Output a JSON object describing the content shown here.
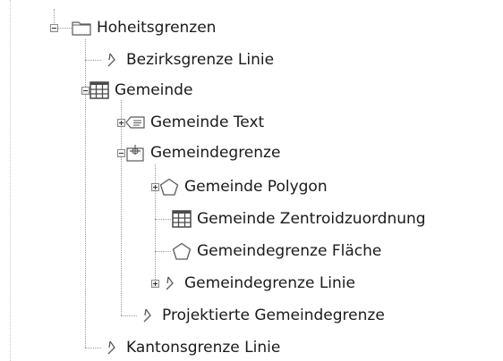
{
  "tree": {
    "root": {
      "label": "Hoheitsgrenzen",
      "icon": "folder-icon",
      "expanded": true,
      "children": [
        {
          "label": "Bezirksgrenze Linie",
          "icon": "line-feature-icon"
        },
        {
          "label": "Gemeinde",
          "icon": "table-icon",
          "expanded": true,
          "children": [
            {
              "label": "Gemeinde Text",
              "icon": "text-feature-icon",
              "expanded": false
            },
            {
              "label": "Gemeindegrenze",
              "icon": "topic-icon",
              "expanded": true,
              "children": [
                {
                  "label": "Gemeinde Polygon",
                  "icon": "polygon-feature-icon",
                  "expanded": false
                },
                {
                  "label": "Gemeinde Zentroidzuordnung",
                  "icon": "table-icon"
                },
                {
                  "label": "Gemeindegrenze Fläche",
                  "icon": "polygon-feature-icon"
                },
                {
                  "label": "Gemeindegrenze Linie",
                  "icon": "line-feature-icon",
                  "expanded": false
                }
              ]
            },
            {
              "label": "Projektierte Gemeindegrenze",
              "icon": "line-feature-icon"
            }
          ]
        },
        {
          "label": "Kantonsgrenze Linie",
          "icon": "line-feature-icon"
        }
      ]
    }
  },
  "colors": {
    "tree_line": "#9a9a9a",
    "icon_stroke": "#5a5a5a",
    "text": "#1a1a1a"
  }
}
